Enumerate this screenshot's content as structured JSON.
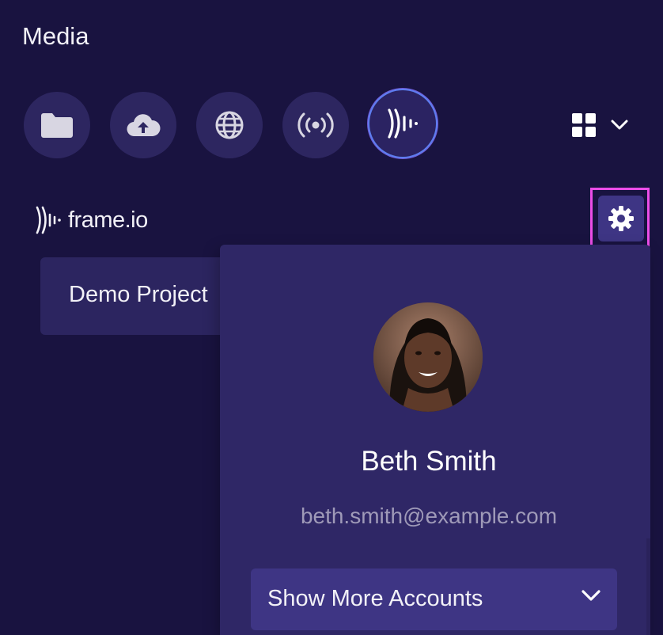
{
  "panel": {
    "title": "Media"
  },
  "sources": [
    {
      "name": "Folder",
      "icon": "folder-icon"
    },
    {
      "name": "Upload",
      "icon": "cloud-upload-icon"
    },
    {
      "name": "Web",
      "icon": "globe-icon"
    },
    {
      "name": "Broadcast",
      "icon": "broadcast-icon"
    },
    {
      "name": "Frame.io",
      "icon": "frameio-icon",
      "active": true
    }
  ],
  "view_toggle": {
    "icon": "grid-icon",
    "chevron": "chevron-down-icon"
  },
  "integration": {
    "logo_text": "frame.io",
    "settings_icon": "gear-icon"
  },
  "projects": [
    {
      "name": "Demo Project"
    }
  ],
  "account": {
    "name": "Beth Smith",
    "email": "beth.smith@example.com",
    "more_accounts_label": "Show More Accounts"
  },
  "colors": {
    "background": "#191340",
    "surface": "#2f2766",
    "button": "#3e3584",
    "highlight_border": "#ec4de8",
    "active_ring": "#5d7ef0",
    "muted_text": "#9f9ab8"
  }
}
